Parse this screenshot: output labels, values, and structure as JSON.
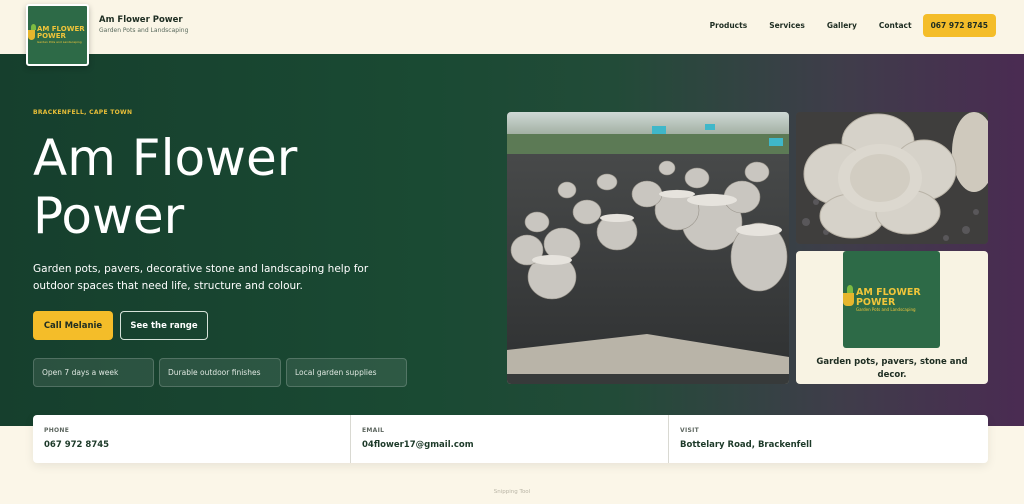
{
  "header": {
    "logo_text": "AM FLOWER POWER",
    "logo_subtext": "Garden Pots and Landscaping",
    "brand_name": "Am Flower Power",
    "brand_tagline": "Garden Pots and Landscaping",
    "nav": [
      "Products",
      "Services",
      "Gallery",
      "Contact"
    ],
    "phone_button": "067 972 8745"
  },
  "hero": {
    "eyebrow": "BRACKENFELL, CAPE TOWN",
    "title": "Am Flower Power",
    "description": "Garden pots, pavers, decorative stone and landscaping help for outdoor spaces that need life, structure and colour.",
    "primary_button": "Call Melanie",
    "secondary_button": "See the range",
    "chips": [
      "Open 7 days a week",
      "Durable outdoor finishes",
      "Local garden supplies"
    ]
  },
  "card": {
    "logo_text": "AM FLOWER POWER",
    "logo_subtext": "Garden Pots and Landscaping",
    "caption": "Garden pots, pavers, stone and decor."
  },
  "contact": [
    {
      "label": "PHONE",
      "value": "067 972 8745"
    },
    {
      "label": "EMAIL",
      "value": "04flower17@gmail.com"
    },
    {
      "label": "VISIT",
      "value": "Bottelary Road, Brackenfell"
    }
  ],
  "footer": {
    "watermark": "Snipping Tool"
  },
  "colors": {
    "accent": "#f4bd29",
    "hero_green": "#163f2d",
    "hero_purple": "#4a2b52",
    "brand_green": "#2d6a47",
    "cream": "#fbf6e8"
  },
  "icons": [
    "pot-logo-icon"
  ]
}
